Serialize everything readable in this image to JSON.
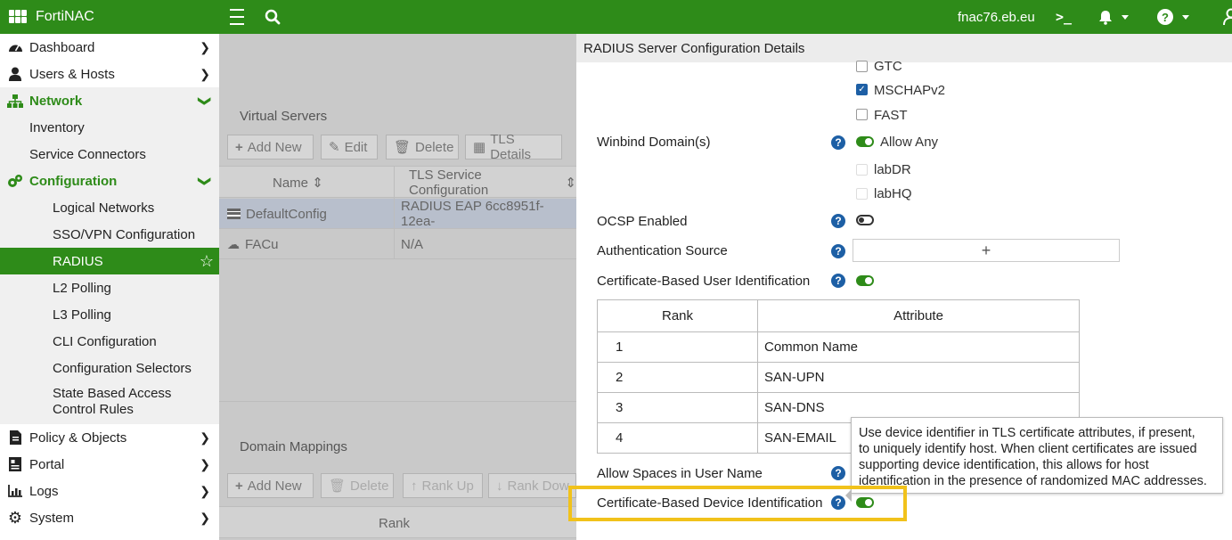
{
  "topbar": {
    "app_name": "FortiNAC",
    "hostname": "fnac76.eb.eu",
    "terminal_glyph": ">_",
    "help_glyph": "?",
    "accent_color": "#2e8b19"
  },
  "sidebar": {
    "items": [
      {
        "label": "Dashboard"
      },
      {
        "label": "Users & Hosts"
      },
      {
        "label": "Network"
      },
      {
        "label": "Inventory"
      },
      {
        "label": "Service Connectors"
      },
      {
        "label": "Configuration"
      },
      {
        "label": "Logical Networks"
      },
      {
        "label": "SSO/VPN Configuration"
      },
      {
        "label": "RADIUS"
      },
      {
        "label": "L2 Polling"
      },
      {
        "label": "L3 Polling"
      },
      {
        "label": "CLI Configuration"
      },
      {
        "label": "Configuration Selectors"
      },
      {
        "label": "State Based Access"
      },
      {
        "label": "Control Rules"
      },
      {
        "label": "Policy & Objects"
      },
      {
        "label": "Portal"
      },
      {
        "label": "Logs"
      },
      {
        "label": "System"
      }
    ]
  },
  "main": {
    "virtual_servers_title": "Virtual Servers",
    "toolbar": {
      "add": "Add New",
      "edit": "Edit",
      "delete": "Delete",
      "tls": "TLS Details"
    },
    "columns": {
      "name": "Name",
      "tls": "TLS Service Configuration"
    },
    "rows": [
      {
        "name": "DefaultConfig",
        "tls": "RADIUS EAP 6cc8951f-12ea-"
      },
      {
        "name": "FACu",
        "tls": "N/A"
      }
    ],
    "domain_mappings_title": "Domain Mappings",
    "toolbar2": {
      "add": "Add New",
      "delete": "Delete",
      "rank_up": "Rank Up",
      "rank_down": "Rank Dow"
    },
    "rank_header": "Rank"
  },
  "panel": {
    "title": "RADIUS Server Configuration Details",
    "eap_options": [
      {
        "label": "GTC",
        "checked": false
      },
      {
        "label": "MSCHAPv2",
        "checked": true
      },
      {
        "label": "FAST",
        "checked": false
      }
    ],
    "winbind_label": "Winbind Domain(s)",
    "allow_any_label": "Allow Any",
    "domains": [
      "labDR",
      "labHQ"
    ],
    "ocsp_label": "OCSP Enabled",
    "auth_source_label": "Authentication Source",
    "add_glyph": "+",
    "cert_user_label": "Certificate-Based User Identification",
    "rank_table": {
      "headers": [
        "Rank",
        "Attribute"
      ],
      "rows": [
        {
          "rank": "1",
          "attribute": "Common Name"
        },
        {
          "rank": "2",
          "attribute": "SAN-UPN"
        },
        {
          "rank": "3",
          "attribute": "SAN-DNS"
        },
        {
          "rank": "4",
          "attribute": "SAN-EMAIL"
        }
      ]
    },
    "allow_spaces_label": "Allow Spaces in User Name",
    "cert_device_label": "Certificate-Based Device Identification",
    "tooltip": {
      "line1": "Use device identifier in TLS certificate attributes, if present,",
      "line2": "to uniquely identify host. When client certificates are issued",
      "line3": "supporting device identification, this allows for host",
      "line4": "identification in the presence of randomized MAC addresses."
    }
  }
}
